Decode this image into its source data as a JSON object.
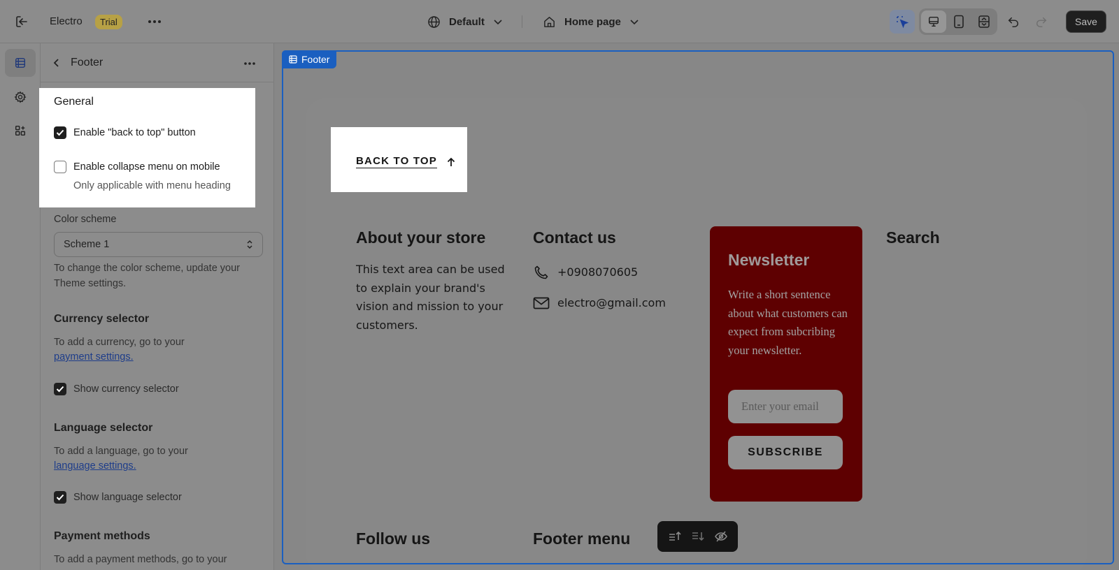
{
  "topbar": {
    "store_name": "Electro",
    "plan_badge": "Trial",
    "theme_selector": "Default",
    "page_selector": "Home page",
    "save_label": "Save"
  },
  "panel": {
    "title": "Footer",
    "general_heading": "General",
    "back_to_top_label": "Enable \"back to top\" button",
    "back_to_top_checked": true,
    "collapse_label": "Enable collapse menu on mobile",
    "collapse_checked": false,
    "collapse_help": "Only applicable with menu heading",
    "color_scheme_label": "Color scheme",
    "color_scheme_value": "Scheme 1",
    "color_scheme_help": "To change the color scheme, update your Theme settings.",
    "currency_heading": "Currency selector",
    "currency_help": "To add a currency, go to your",
    "currency_link": "payment settings.",
    "show_currency_label": "Show currency selector",
    "language_heading": "Language selector",
    "language_help": "To add a language, go to your",
    "language_link": "language settings.",
    "show_language_label": "Show language selector",
    "payment_heading": "Payment methods",
    "payment_help": "To add a payment methods, go to your"
  },
  "canvas": {
    "section_tag": "Footer",
    "back_to_top": "BACK TO TOP",
    "about_heading": "About your store",
    "about_body": "This text area can be used to explain your brand's vision and mission to your customers.",
    "contact_heading": "Contact us",
    "contact_phone": "+0908070605",
    "contact_email": "electro@gmail.com",
    "newsletter_heading": "Newsletter",
    "newsletter_body": "Write a short sentence about what customers can expect from subcribing your newsletter.",
    "newsletter_placeholder": "Enter your email",
    "subscribe_label": "SUBSCRIBE",
    "search_heading": "Search",
    "follow_heading": "Follow us",
    "footer_menu_heading": "Footer menu"
  },
  "colors": {
    "selection_blue": "#1a5fc0",
    "newsletter_bg": "#5e0001",
    "save_bg": "#1f1f1f"
  },
  "icons": [
    "exit-icon",
    "more-horizontal-icon",
    "globe-icon",
    "chevron-down-icon",
    "home-icon",
    "select-element-icon",
    "desktop-icon",
    "mobile-icon",
    "fullwidth-icon",
    "undo-icon",
    "redo-icon",
    "sections-icon",
    "settings-gear-icon",
    "apps-icon",
    "back-chevron-icon",
    "phone-icon",
    "mail-icon",
    "arrow-up-icon",
    "move-up-icon",
    "move-down-icon",
    "hide-icon"
  ]
}
